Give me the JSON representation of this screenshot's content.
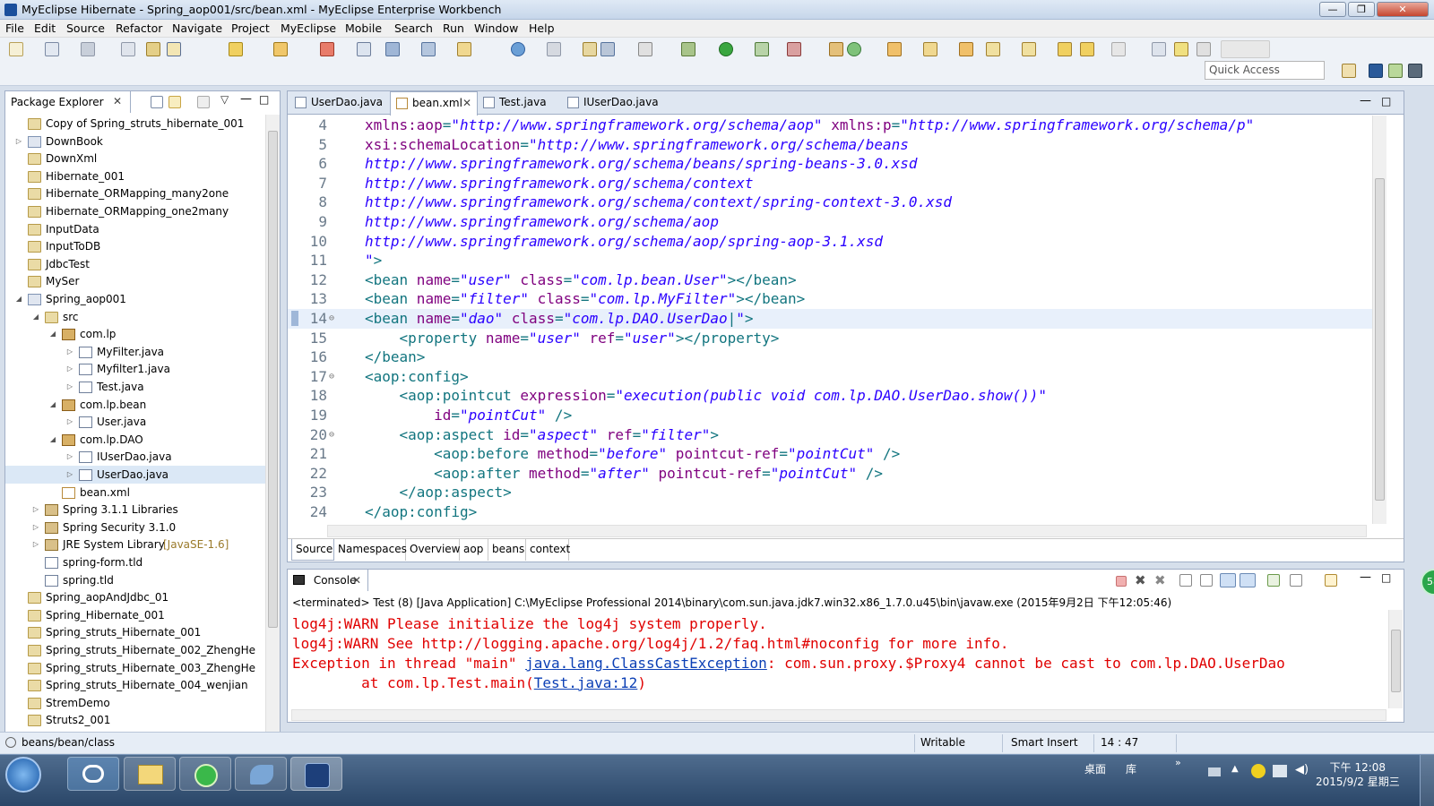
{
  "window": {
    "title": "MyEclipse Hibernate - Spring_aop001/src/bean.xml - MyEclipse Enterprise Workbench",
    "min": "—",
    "max": "❐",
    "close": "✕"
  },
  "menu": [
    "File",
    "Edit",
    "Source",
    "Refactor",
    "Navigate",
    "Project",
    "MyEclipse",
    "Mobile",
    "Search",
    "Run",
    "Window",
    "Help"
  ],
  "toolbar": {
    "quick_access_placeholder": "Quick Access"
  },
  "package_explorer": {
    "title": "Package Explorer",
    "tree": [
      {
        "label": "Copy of Spring_struts_hibernate_001",
        "indent": 0,
        "icon": "folder",
        "tw": ""
      },
      {
        "label": "DownBook",
        "indent": 0,
        "icon": "project",
        "tw": "▷"
      },
      {
        "label": "DownXml",
        "indent": 0,
        "icon": "folder",
        "tw": ""
      },
      {
        "label": "Hibernate_001",
        "indent": 0,
        "icon": "folder",
        "tw": ""
      },
      {
        "label": "Hibernate_ORMapping_many2one",
        "indent": 0,
        "icon": "folder",
        "tw": ""
      },
      {
        "label": "Hibernate_ORMapping_one2many",
        "indent": 0,
        "icon": "folder",
        "tw": ""
      },
      {
        "label": "InputData",
        "indent": 0,
        "icon": "folder",
        "tw": ""
      },
      {
        "label": "InputToDB",
        "indent": 0,
        "icon": "folder",
        "tw": ""
      },
      {
        "label": "JdbcTest",
        "indent": 0,
        "icon": "folder",
        "tw": ""
      },
      {
        "label": "MySer",
        "indent": 0,
        "icon": "folder",
        "tw": ""
      },
      {
        "label": "Spring_aop001",
        "indent": 0,
        "icon": "project",
        "tw": "◢"
      },
      {
        "label": "src",
        "indent": 1,
        "icon": "folder",
        "tw": "◢"
      },
      {
        "label": "com.lp",
        "indent": 2,
        "icon": "package",
        "tw": "◢"
      },
      {
        "label": "MyFilter.java",
        "indent": 3,
        "icon": "java",
        "tw": "▷"
      },
      {
        "label": "Myfilter1.java",
        "indent": 3,
        "icon": "java",
        "tw": "▷"
      },
      {
        "label": "Test.java",
        "indent": 3,
        "icon": "java",
        "tw": "▷"
      },
      {
        "label": "com.lp.bean",
        "indent": 2,
        "icon": "package",
        "tw": "◢"
      },
      {
        "label": "User.java",
        "indent": 3,
        "icon": "java",
        "tw": "▷"
      },
      {
        "label": "com.lp.DAO",
        "indent": 2,
        "icon": "package",
        "tw": "◢"
      },
      {
        "label": "IUserDao.java",
        "indent": 3,
        "icon": "java",
        "tw": "▷"
      },
      {
        "label": "UserDao.java",
        "indent": 3,
        "icon": "java",
        "tw": "▷",
        "selected": true
      },
      {
        "label": "bean.xml",
        "indent": 2,
        "icon": "xml",
        "tw": ""
      },
      {
        "label": "Spring 3.1.1 Libraries",
        "indent": 1,
        "icon": "lib",
        "tw": "▷"
      },
      {
        "label": "Spring Security 3.1.0",
        "indent": 1,
        "icon": "lib",
        "tw": "▷"
      },
      {
        "label": "JRE System Library",
        "indent": 1,
        "icon": "lib",
        "tw": "▷",
        "suffix": "[JavaSE-1.6]"
      },
      {
        "label": "spring-form.tld",
        "indent": 1,
        "icon": "java",
        "tw": ""
      },
      {
        "label": "spring.tld",
        "indent": 1,
        "icon": "java",
        "tw": ""
      },
      {
        "label": "Spring_aopAndJdbc_01",
        "indent": 0,
        "icon": "folder",
        "tw": ""
      },
      {
        "label": "Spring_Hibernate_001",
        "indent": 0,
        "icon": "folder",
        "tw": ""
      },
      {
        "label": "Spring_struts_Hibernate_001",
        "indent": 0,
        "icon": "folder",
        "tw": ""
      },
      {
        "label": "Spring_struts_Hibernate_002_ZhengHe",
        "indent": 0,
        "icon": "folder",
        "tw": ""
      },
      {
        "label": "Spring_struts_Hibernate_003_ZhengHe",
        "indent": 0,
        "icon": "folder",
        "tw": ""
      },
      {
        "label": "Spring_struts_Hibernate_004_wenjian",
        "indent": 0,
        "icon": "folder",
        "tw": ""
      },
      {
        "label": "StremDemo",
        "indent": 0,
        "icon": "folder",
        "tw": ""
      },
      {
        "label": "Struts2_001",
        "indent": 0,
        "icon": "folder",
        "tw": ""
      }
    ]
  },
  "editor": {
    "tabs": [
      {
        "label": "UserDao.java",
        "active": false,
        "close": ""
      },
      {
        "label": "bean.xml",
        "active": true,
        "close": "✕"
      },
      {
        "label": "Test.java",
        "active": false,
        "close": ""
      },
      {
        "label": "IUserDao.java",
        "active": false,
        "close": ""
      }
    ],
    "lines": [
      {
        "n": "4",
        "fold": "",
        "segs": [
          [
            "at",
            "xmlns:aop"
          ],
          [
            "sy",
            "="
          ],
          [
            "vl",
            "\"http://www.springframework.org/schema/aop\""
          ],
          [
            "at",
            " xmlns:p"
          ],
          [
            "sy",
            "="
          ],
          [
            "vl",
            "\"http://www.springframework.org/schema/p\""
          ]
        ]
      },
      {
        "n": "5",
        "fold": "",
        "segs": [
          [
            "at",
            "xsi:schemaLocation"
          ],
          [
            "sy",
            "="
          ],
          [
            "vl",
            "\"http://www.springframework.org/schema/beans"
          ]
        ]
      },
      {
        "n": "6",
        "fold": "",
        "segs": [
          [
            "vl",
            "http://www.springframework.org/schema/beans/spring-beans-3.0.xsd"
          ]
        ]
      },
      {
        "n": "7",
        "fold": "",
        "segs": [
          [
            "vl",
            "http://www.springframework.org/schema/context"
          ]
        ]
      },
      {
        "n": "8",
        "fold": "",
        "segs": [
          [
            "vl",
            "http://www.springframework.org/schema/context/spring-context-3.0.xsd"
          ]
        ]
      },
      {
        "n": "9",
        "fold": "",
        "segs": [
          [
            "vl",
            "http://www.springframework.org/schema/aop"
          ]
        ]
      },
      {
        "n": "10",
        "fold": "",
        "segs": [
          [
            "vl",
            "http://www.springframework.org/schema/aop/spring-aop-3.1.xsd"
          ]
        ]
      },
      {
        "n": "11",
        "fold": "",
        "segs": [
          [
            "vl",
            "\""
          ],
          [
            "tg",
            ">"
          ]
        ]
      },
      {
        "n": "12",
        "fold": "",
        "segs": [
          [
            "tg",
            "<bean"
          ],
          [
            "at",
            " name"
          ],
          [
            "sy",
            "="
          ],
          [
            "vl",
            "\"user\""
          ],
          [
            "at",
            " class"
          ],
          [
            "sy",
            "="
          ],
          [
            "vl",
            "\"com.lp.bean.User\""
          ],
          [
            "tg",
            "></bean>"
          ]
        ]
      },
      {
        "n": "13",
        "fold": "",
        "segs": [
          [
            "tg",
            "<bean"
          ],
          [
            "at",
            " name"
          ],
          [
            "sy",
            "="
          ],
          [
            "vl",
            "\"filter\""
          ],
          [
            "at",
            " class"
          ],
          [
            "sy",
            "="
          ],
          [
            "vl",
            "\"com.lp.MyFilter\""
          ],
          [
            "tg",
            "></bean>"
          ]
        ]
      },
      {
        "n": "14",
        "fold": "⊖",
        "current": true,
        "segs": [
          [
            "tg",
            "<bean"
          ],
          [
            "at",
            " name"
          ],
          [
            "sy",
            "="
          ],
          [
            "vl",
            "\"dao\""
          ],
          [
            "at",
            " class"
          ],
          [
            "sy",
            "="
          ],
          [
            "vl",
            "\"com.lp.DAO.UserDao"
          ],
          [
            "sy",
            "|"
          ],
          [
            "vl",
            "\""
          ],
          [
            "tg",
            ">"
          ]
        ]
      },
      {
        "n": "15",
        "fold": "",
        "segs": [
          [
            "tg",
            "    <property"
          ],
          [
            "at",
            " name"
          ],
          [
            "sy",
            "="
          ],
          [
            "vl",
            "\"user\""
          ],
          [
            "at",
            " ref"
          ],
          [
            "sy",
            "="
          ],
          [
            "vl",
            "\"user\""
          ],
          [
            "tg",
            "></property>"
          ]
        ]
      },
      {
        "n": "16",
        "fold": "",
        "segs": [
          [
            "tg",
            "</bean>"
          ]
        ]
      },
      {
        "n": "17",
        "fold": "⊖",
        "segs": [
          [
            "tg",
            "<aop:config>"
          ]
        ]
      },
      {
        "n": "18",
        "fold": "",
        "segs": [
          [
            "tg",
            "    <aop:pointcut"
          ],
          [
            "at",
            " expression"
          ],
          [
            "sy",
            "="
          ],
          [
            "vl",
            "\"execution(public void com.lp.DAO.UserDao.show())\""
          ]
        ]
      },
      {
        "n": "19",
        "fold": "",
        "segs": [
          [
            "at",
            "        id"
          ],
          [
            "sy",
            "="
          ],
          [
            "vl",
            "\"pointCut\""
          ],
          [
            "tg",
            " />"
          ]
        ]
      },
      {
        "n": "20",
        "fold": "⊖",
        "segs": [
          [
            "tg",
            "    <aop:aspect"
          ],
          [
            "at",
            " id"
          ],
          [
            "sy",
            "="
          ],
          [
            "vl",
            "\"aspect\""
          ],
          [
            "at",
            " ref"
          ],
          [
            "sy",
            "="
          ],
          [
            "vl",
            "\"filter\""
          ],
          [
            "tg",
            ">"
          ]
        ]
      },
      {
        "n": "21",
        "fold": "",
        "segs": [
          [
            "tg",
            "        <aop:before"
          ],
          [
            "at",
            " method"
          ],
          [
            "sy",
            "="
          ],
          [
            "vl",
            "\"before\""
          ],
          [
            "at",
            " pointcut-ref"
          ],
          [
            "sy",
            "="
          ],
          [
            "vl",
            "\"pointCut\""
          ],
          [
            "tg",
            " />"
          ]
        ]
      },
      {
        "n": "22",
        "fold": "",
        "segs": [
          [
            "tg",
            "        <aop:after"
          ],
          [
            "at",
            " method"
          ],
          [
            "sy",
            "="
          ],
          [
            "vl",
            "\"after\""
          ],
          [
            "at",
            " pointcut-ref"
          ],
          [
            "sy",
            "="
          ],
          [
            "vl",
            "\"pointCut\""
          ],
          [
            "tg",
            " />"
          ]
        ]
      },
      {
        "n": "23",
        "fold": "",
        "segs": [
          [
            "tg",
            "    </aop:aspect>"
          ]
        ]
      },
      {
        "n": "24",
        "fold": "",
        "segs": [
          [
            "tg",
            "</aop:config>"
          ]
        ]
      }
    ],
    "page_tabs": [
      {
        "label": "Source",
        "active": true
      },
      {
        "label": "Namespaces"
      },
      {
        "label": "Overview"
      },
      {
        "label": "aop"
      },
      {
        "label": "beans"
      },
      {
        "label": "context"
      }
    ]
  },
  "console": {
    "title": "Console",
    "close": "✕",
    "description": "<terminated> Test (8) [Java Application] C:\\MyEclipse Professional 2014\\binary\\com.sun.java.jdk7.win32.x86_1.7.0.u45\\bin\\javaw.exe (2015年9月2日 下午12:05:46)",
    "line1": "log4j:WARN Please initialize the log4j system properly.",
    "line2": "log4j:WARN See http://logging.apache.org/log4j/1.2/faq.html#noconfig for more info.",
    "line3_pre": "Exception in thread \"main\" ",
    "line3_link": "java.lang.ClassCastException",
    "line3_post": ": com.sun.proxy.$Proxy4 cannot be cast to com.lp.DAO.UserDao",
    "line4_pre": "        at com.lp.Test.main(",
    "line4_link": "Test.java:12",
    "line4_post": ")"
  },
  "badge": "58",
  "status": {
    "path": "beans/bean/class",
    "writable": "Writable",
    "insert": "Smart Insert",
    "position": "14 : 47"
  },
  "taskbar": {
    "tray_desktop": "桌面",
    "tray_lib": "库",
    "time": "下午 12:08",
    "date": "2015/9/2 星期三"
  },
  "colors": {
    "tag": "#12757f",
    "attr": "#7f007f",
    "value": "#2a00ff",
    "error": "#e00000",
    "link": "#0b3fb5"
  }
}
